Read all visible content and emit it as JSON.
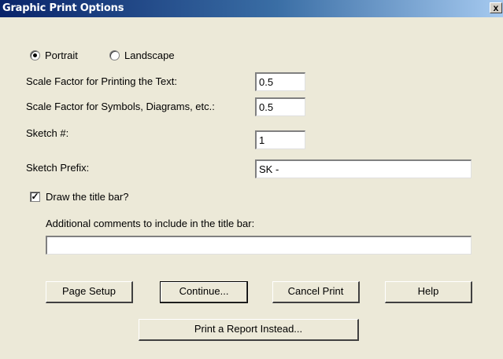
{
  "window": {
    "title": "Graphic Print Options",
    "close_glyph": "x"
  },
  "orientation": {
    "portrait_label": "Portrait",
    "landscape_label": "Landscape",
    "selected": "portrait"
  },
  "fields": {
    "scale_text_label": "Scale Factor for Printing the Text:",
    "scale_text_value": "0.5",
    "scale_symbols_label": "Scale Factor for Symbols, Diagrams, etc.:",
    "scale_symbols_value": "0.5",
    "sketch_number_label": "Sketch #:",
    "sketch_number_value": "1",
    "sketch_prefix_label": "Sketch Prefix:",
    "sketch_prefix_value": "SK -"
  },
  "title_bar_option": {
    "checkbox_label": "Draw the title bar?",
    "checked": true,
    "comments_label": "Additional comments to include in the title bar:",
    "comments_value": ""
  },
  "buttons": {
    "page_setup": "Page Setup",
    "continue": "Continue...",
    "cancel_print": "Cancel Print",
    "help": "Help",
    "print_report": "Print a Report Instead..."
  },
  "colors": {
    "titlebar_start": "#0a246a",
    "titlebar_end": "#a6caf0",
    "dialog_bg": "#ece9d8"
  }
}
